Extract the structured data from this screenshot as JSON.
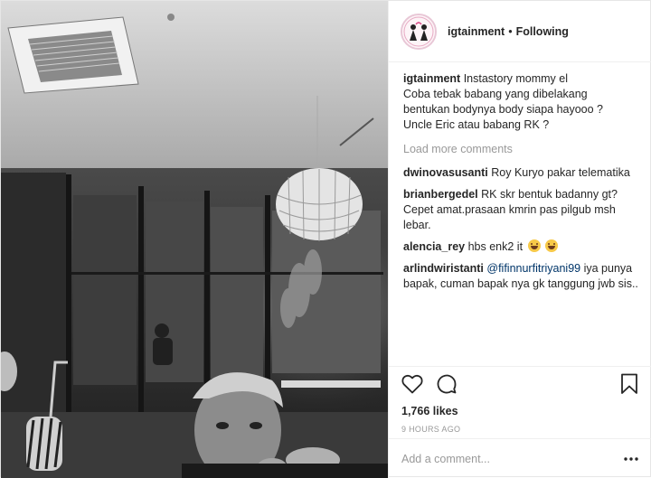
{
  "post": {
    "username": "igtainment",
    "separator": "•",
    "follow_status": "Following",
    "caption": {
      "username": "igtainment",
      "lines": [
        "Instastory mommy el",
        "Coba tebak babang yang dibelakang",
        "bentukan bodynya body siapa hayooo ?",
        "Uncle Eric atau babang RK ?"
      ]
    },
    "load_more": "Load more comments",
    "comments": [
      {
        "username": "dwinovasusanti",
        "text": "Roy Kuryo pakar telematika"
      },
      {
        "username": "brianbergedel",
        "text": "RK skr bentuk badanny gt? Cepet amat.prasaan kmrin pas pilgub msh lebar."
      },
      {
        "username": "alencia_rey",
        "text": "hbs enk2 it"
      },
      {
        "username": "arlindwiristanti",
        "mention": "@fifinnurfitriyani99",
        "text": "iya punya bapak, cuman bapak nya gk tanggung jwb sis.."
      }
    ],
    "likes": "1,766 likes",
    "time_ago": "9 HOURS AGO",
    "add_comment_placeholder": "Add a comment...",
    "icons": {
      "like": "heart-icon",
      "comment": "comment-bubble-icon",
      "save": "bookmark-icon",
      "more": "more-options-icon"
    }
  }
}
